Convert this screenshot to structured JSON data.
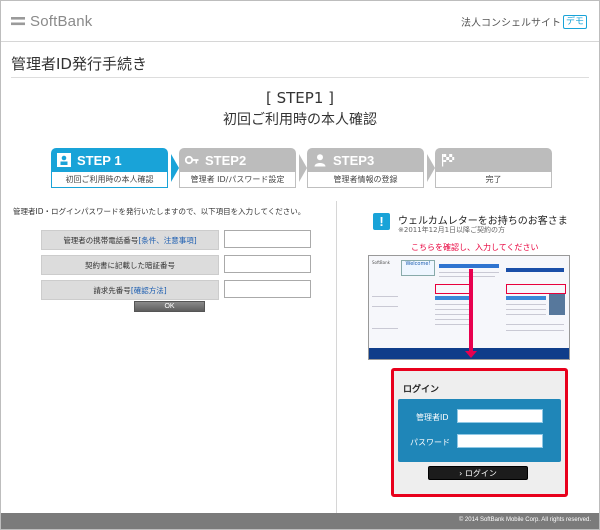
{
  "header": {
    "brand": "SoftBank",
    "site_name": "法人コンシェルサイト",
    "demo_badge": "デモ"
  },
  "page_title": "管理者ID発行手続き",
  "step_heading": "[ STEP1 ]",
  "step_subtitle": "初回ご利用時の本人確認",
  "steps": [
    {
      "label": "STEP 1",
      "caption": "初回ご利用時の本人確認",
      "state": "active",
      "icon": "id-card-icon"
    },
    {
      "label": "STEP2",
      "caption": "管理者 ID/パスワード設定",
      "state": "inactive",
      "icon": "key-icon"
    },
    {
      "label": "STEP3",
      "caption": "管理者情報の登録",
      "state": "inactive",
      "icon": "person-icon"
    },
    {
      "label": "",
      "caption": "完了",
      "state": "inactive",
      "icon": "checkered-flag-icon"
    }
  ],
  "instruction": "管理者ID・ログインパスワードを発行いたしますので、以下項目を入力してください。",
  "form": {
    "fields": [
      {
        "label": "管理者の携帯電話番号",
        "link": "[条件、注意事項]",
        "value": ""
      },
      {
        "label": "契約書に記載した暗証番号",
        "link": "",
        "value": ""
      },
      {
        "label": "請求先番号",
        "link": "[確認方法]",
        "value": ""
      }
    ],
    "ok_label": "OK"
  },
  "welcome": {
    "icon_glyph": "!",
    "title": "ウェルカムレターをお持ちのお客さま",
    "note": "※2011年12月1日以降ご契約の方",
    "cta": "こちらを確認し、入力してください",
    "letter_welcome": "Welcome!"
  },
  "login": {
    "title": "ログイン",
    "admin_id_label": "管理者ID",
    "password_label": "パスワード",
    "admin_id_value": "",
    "password_value": "",
    "button_label": "› ログイン"
  },
  "footer": {
    "copyright": "© 2014 SoftBank Mobile Corp. All rights reserved."
  },
  "colors": {
    "accent": "#19a3d8",
    "highlight_red": "#e8001c",
    "footer_gray": "#7b7b7b"
  }
}
